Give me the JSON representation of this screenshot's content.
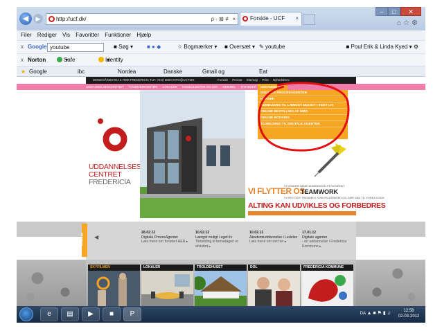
{
  "browser": {
    "url": "http://ucf.dk/",
    "url_actions": "ρ - ⊠ ≢ ×",
    "tab_title": "Forside - UCF",
    "tab_close": "×",
    "menu": [
      "Filer",
      "Rediger",
      "Vis",
      "Favoritter",
      "Funktioner",
      "Hjælp"
    ],
    "google_toolbar": {
      "close": "x",
      "logo": "Google",
      "query": "youtube",
      "search_label": "Søg",
      "bookmarks_label": "Bogmærker",
      "translate_label": "Oversæt",
      "youtube_label": "youtube",
      "user": "Poul Erik & Linda Kyed"
    },
    "norton_toolbar": {
      "close": "x",
      "norton": "Norton",
      "safe_web": "Safe Web",
      "identity_safe": "Identity Safe"
    },
    "favorites": [
      "Google Oversat",
      "ibc Mit hjem",
      "Nordea Netbank",
      "Danske Spil",
      "Gmail og Kalender",
      "Eat Right For Your Type T..."
    ]
  },
  "site": {
    "contact": "MOSEGÅRDSVEJ 2   7000 FREDERICIA   TLF: 7210 3600   INFO@UCF.DK",
    "top_nav": [
      "Forside",
      "Presse",
      "Sitemap",
      "Print",
      "Nyhedsbrev"
    ],
    "pink_nav": [
      "UDDANNELSESCENTRET",
      "HANDVERKSMTØR",
      "LOKALER",
      "KONSULENTER OG DIG",
      "NEMMEL",
      "NYHEDER"
    ],
    "active_menu": "UDDANNELSER",
    "dropdown": [
      "DIGITALE PROCESAGENTER",
      "KURSER",
      "UDMELDING TIL LÆNGST MULIGT I EGET LIV",
      "ONLINE BESTILLING AF MØD",
      "ONLINE BOOKING",
      "TILMELDING TIL DIGITALE AGENTER"
    ],
    "logo": [
      "UDDANNELSES",
      "CENTRET",
      "FREDERICIA"
    ],
    "banner": {
      "headline": "VI FLYTTER OS",
      "teamwork": "TEAMWORK",
      "vi_vender": "VI VENDER VANETÆNKNINGEN PÅ HOVEDET",
      "spotter": "VI SPOTTER TRENDEN I KVALIFICERINGEN OG GØR DEN TIL VORES EGEN",
      "alting": "ALTING KAN UDVIKLES OG FORBEDRES"
    },
    "news_tab": "NYHEDER",
    "news": [
      {
        "date": "28.02.12",
        "title": "Digitale ProcesAgenter",
        "more": "Læs mere om forløbet HER ▸"
      },
      {
        "date": "10.02.12",
        "title": "Længst muligt i eget liv",
        "more": "Tilmelding til temadagen er afsluttet ▸"
      },
      {
        "date": "10.02.12",
        "title": "Akademiuddannelse i Ledelse",
        "more": "Læs mere om det her ▸"
      },
      {
        "date": "17.01.12",
        "title": "Digitale agenter",
        "more": "- en uddannelse i Fredericia Kommune ▸"
      }
    ],
    "tiles": [
      "SKYFILMEN",
      "LOKALER",
      "TROLDEHUSET",
      "DOL",
      "FREDERICIA KOMMUNE"
    ]
  },
  "taskbar": {
    "lang": "DA",
    "time": "12:58",
    "date": "02-03-2012"
  },
  "colors": {
    "brand_red": "#c41d1d",
    "orange": "#f6a623",
    "pink": "#f07caa",
    "annotation_red": "#e01010"
  }
}
